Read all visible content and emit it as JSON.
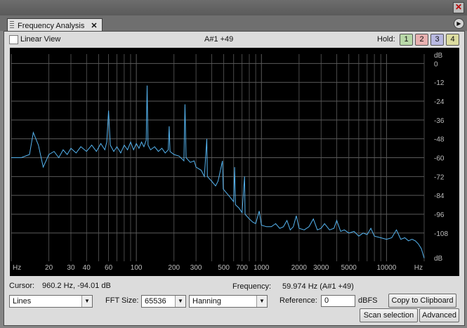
{
  "window": {
    "close_symbol": "✕"
  },
  "tab": {
    "title": "Frequency Analysis",
    "close_symbol": "✕"
  },
  "toolbar": {
    "linear_view_label": "Linear View",
    "linear_view_checked": false,
    "note_readout": "A#1 +49",
    "hold_label": "Hold:",
    "hold_buttons": [
      {
        "label": "1",
        "color": "#b8d8a8"
      },
      {
        "label": "2",
        "color": "#e8b0b0"
      },
      {
        "label": "3",
        "color": "#b8b8e0"
      },
      {
        "label": "4",
        "color": "#dcdca0"
      }
    ]
  },
  "chart_data": {
    "type": "line",
    "x_scale": "log",
    "xlim": [
      10,
      20000
    ],
    "ylim": [
      -126,
      6
    ],
    "x_ticks": [
      {
        "value": 20,
        "label": "20"
      },
      {
        "value": 30,
        "label": "30"
      },
      {
        "value": 40,
        "label": "40"
      },
      {
        "value": 60,
        "label": "60"
      },
      {
        "value": 100,
        "label": "100"
      },
      {
        "value": 200,
        "label": "200"
      },
      {
        "value": 300,
        "label": "300"
      },
      {
        "value": 500,
        "label": "500"
      },
      {
        "value": 700,
        "label": "700"
      },
      {
        "value": 1000,
        "label": "1000"
      },
      {
        "value": 2000,
        "label": "2000"
      },
      {
        "value": 3000,
        "label": "3000"
      },
      {
        "value": 5000,
        "label": "5000"
      },
      {
        "value": 10000,
        "label": "10000"
      }
    ],
    "x_unit_left": "Hz",
    "x_unit_right": "Hz",
    "y_ticks": [
      0,
      -12,
      -24,
      -36,
      -48,
      -60,
      -72,
      -84,
      -96,
      -108
    ],
    "y_unit_top": "dB",
    "y_unit_bottom": "dB",
    "grid": true,
    "colors": {
      "background": "#000000",
      "grid": "#5a5a5a",
      "line": "#55b4f0"
    },
    "series": [
      {
        "points": [
          [
            10,
            -60
          ],
          [
            12,
            -60
          ],
          [
            14,
            -58
          ],
          [
            15,
            -44
          ],
          [
            16.5,
            -52
          ],
          [
            18,
            -66
          ],
          [
            20,
            -58
          ],
          [
            22,
            -56
          ],
          [
            24,
            -60
          ],
          [
            26,
            -55
          ],
          [
            28,
            -58
          ],
          [
            30,
            -54
          ],
          [
            33,
            -57
          ],
          [
            36,
            -53
          ],
          [
            40,
            -56
          ],
          [
            44,
            -52
          ],
          [
            48,
            -56
          ],
          [
            52,
            -51
          ],
          [
            56,
            -55
          ],
          [
            58,
            -50
          ],
          [
            60,
            -30
          ],
          [
            62,
            -52
          ],
          [
            66,
            -56
          ],
          [
            70,
            -53
          ],
          [
            75,
            -57
          ],
          [
            80,
            -52
          ],
          [
            85,
            -55
          ],
          [
            90,
            -50
          ],
          [
            95,
            -55
          ],
          [
            100,
            -51
          ],
          [
            105,
            -54
          ],
          [
            110,
            -50
          ],
          [
            115,
            -53
          ],
          [
            120,
            -49
          ],
          [
            122,
            -14
          ],
          [
            124,
            -52
          ],
          [
            130,
            -55
          ],
          [
            140,
            -53
          ],
          [
            150,
            -56
          ],
          [
            160,
            -54
          ],
          [
            170,
            -57
          ],
          [
            180,
            -55
          ],
          [
            183,
            -40
          ],
          [
            186,
            -56
          ],
          [
            200,
            -58
          ],
          [
            220,
            -59
          ],
          [
            240,
            -62
          ],
          [
            245,
            -26
          ],
          [
            250,
            -60
          ],
          [
            270,
            -63
          ],
          [
            290,
            -62
          ],
          [
            300,
            -66
          ],
          [
            330,
            -68
          ],
          [
            350,
            -72
          ],
          [
            366,
            -48
          ],
          [
            370,
            -72
          ],
          [
            400,
            -75
          ],
          [
            430,
            -78
          ],
          [
            450,
            -75
          ],
          [
            488,
            -62
          ],
          [
            495,
            -80
          ],
          [
            520,
            -82
          ],
          [
            560,
            -85
          ],
          [
            600,
            -88
          ],
          [
            611,
            -66
          ],
          [
            620,
            -90
          ],
          [
            660,
            -92
          ],
          [
            700,
            -95
          ],
          [
            733,
            -72
          ],
          [
            740,
            -96
          ],
          [
            800,
            -99
          ],
          [
            850,
            -101
          ],
          [
            900,
            -102
          ],
          [
            960,
            -94
          ],
          [
            1000,
            -103
          ],
          [
            1100,
            -104
          ],
          [
            1200,
            -104
          ],
          [
            1300,
            -102
          ],
          [
            1400,
            -105
          ],
          [
            1500,
            -104
          ],
          [
            1600,
            -100
          ],
          [
            1700,
            -106
          ],
          [
            1800,
            -104
          ],
          [
            1900,
            -97
          ],
          [
            2000,
            -105
          ],
          [
            2200,
            -106
          ],
          [
            2400,
            -104
          ],
          [
            2600,
            -99
          ],
          [
            2800,
            -106
          ],
          [
            3000,
            -105
          ],
          [
            3200,
            -102
          ],
          [
            3500,
            -106
          ],
          [
            3800,
            -105
          ],
          [
            4000,
            -100
          ],
          [
            4300,
            -107
          ],
          [
            4600,
            -106
          ],
          [
            5000,
            -108
          ],
          [
            5500,
            -107
          ],
          [
            6000,
            -110
          ],
          [
            6500,
            -108
          ],
          [
            7000,
            -109
          ],
          [
            7500,
            -105
          ],
          [
            8000,
            -110
          ],
          [
            9000,
            -111
          ],
          [
            10000,
            -112
          ],
          [
            11000,
            -111
          ],
          [
            12000,
            -106
          ],
          [
            13000,
            -112
          ],
          [
            14000,
            -111
          ],
          [
            15000,
            -113
          ],
          [
            16000,
            -112
          ],
          [
            17000,
            -113
          ],
          [
            18000,
            -115
          ],
          [
            19000,
            -118
          ],
          [
            20000,
            -124
          ]
        ]
      }
    ]
  },
  "status": {
    "cursor_label": "Cursor:",
    "cursor_value": "960.2 Hz, -94.01 dB",
    "frequency_label": "Frequency:",
    "frequency_value": "59.974 Hz (A#1 +49)"
  },
  "controls": {
    "display_mode": "Lines",
    "fft_size_label": "FFT Size:",
    "fft_size": "65536",
    "window_function": "Hanning",
    "reference_label": "Reference:",
    "reference_value": "0",
    "reference_unit": "dBFS",
    "copy_button": "Copy to Clipboard",
    "scan_button": "Scan selection",
    "advanced_button": "Advanced"
  }
}
